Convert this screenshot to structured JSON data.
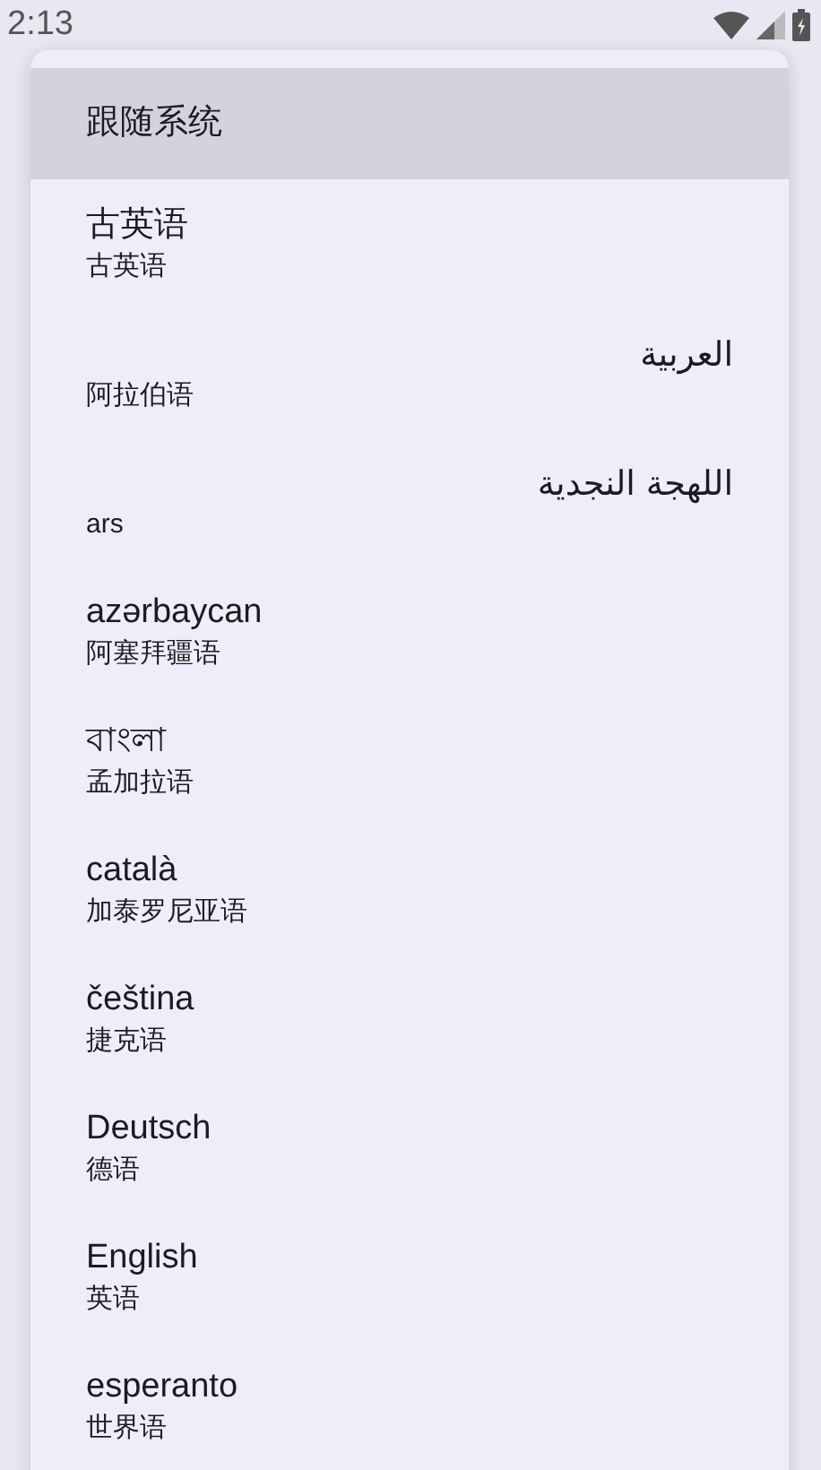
{
  "status_bar": {
    "time": "2:13"
  },
  "menu": {
    "items": [
      {
        "kind": "single",
        "label": "跟随系统",
        "selected": true
      },
      {
        "kind": "double",
        "label": "古英语",
        "sublabel": "古英语",
        "rtl": false,
        "selected": false
      },
      {
        "kind": "double",
        "label": "العربية",
        "sublabel": "阿拉伯语",
        "rtl": true,
        "selected": false
      },
      {
        "kind": "double",
        "label": "اللهجة النجدية",
        "sublabel": "ars",
        "rtl": true,
        "selected": false
      },
      {
        "kind": "double",
        "label": "azərbaycan",
        "sublabel": "阿塞拜疆语",
        "rtl": false,
        "selected": false
      },
      {
        "kind": "double",
        "label": "বাংলা",
        "sublabel": "孟加拉语",
        "rtl": false,
        "selected": false
      },
      {
        "kind": "double",
        "label": "català",
        "sublabel": "加泰罗尼亚语",
        "rtl": false,
        "selected": false
      },
      {
        "kind": "double",
        "label": "čeština",
        "sublabel": "捷克语",
        "rtl": false,
        "selected": false
      },
      {
        "kind": "double",
        "label": "Deutsch",
        "sublabel": "德语",
        "rtl": false,
        "selected": false
      },
      {
        "kind": "double",
        "label": "English",
        "sublabel": "英语",
        "rtl": false,
        "selected": false
      },
      {
        "kind": "double",
        "label": "esperanto",
        "sublabel": "世界语",
        "rtl": false,
        "selected": false
      }
    ]
  }
}
